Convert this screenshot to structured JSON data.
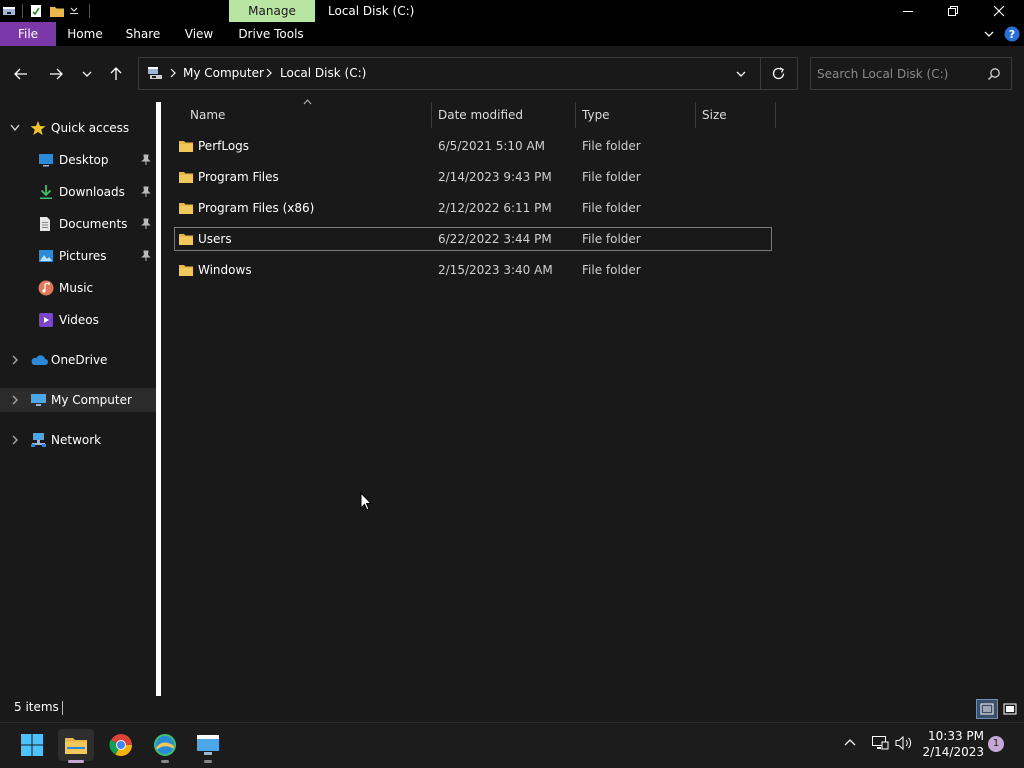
{
  "window": {
    "contextual_tab": "Manage",
    "title": "Local Disk (C:)"
  },
  "ribbon": {
    "tabs": [
      "File",
      "Home",
      "Share",
      "View",
      "Drive Tools"
    ]
  },
  "address": {
    "crumbs": [
      "My Computer",
      "Local Disk (C:)"
    ]
  },
  "search": {
    "placeholder": "Search Local Disk (C:)"
  },
  "nav_pane": {
    "quick_access": "Quick access",
    "pinned": [
      {
        "label": "Desktop",
        "icon": "desktop-icon"
      },
      {
        "label": "Downloads",
        "icon": "downloads-icon"
      },
      {
        "label": "Documents",
        "icon": "documents-icon"
      },
      {
        "label": "Pictures",
        "icon": "pictures-icon"
      }
    ],
    "library": [
      {
        "label": "Music",
        "icon": "music-icon"
      },
      {
        "label": "Videos",
        "icon": "videos-icon"
      }
    ],
    "onedrive": "OneDrive",
    "mycomputer": "My Computer",
    "network": "Network"
  },
  "columns": {
    "name": "Name",
    "date": "Date modified",
    "type": "Type",
    "size": "Size"
  },
  "files": [
    {
      "name": "PerfLogs",
      "date": "6/5/2021 5:10 AM",
      "type": "File folder"
    },
    {
      "name": "Program Files",
      "date": "2/14/2023 9:43 PM",
      "type": "File folder"
    },
    {
      "name": "Program Files (x86)",
      "date": "2/12/2022 6:11 PM",
      "type": "File folder"
    },
    {
      "name": "Users",
      "date": "6/22/2022 3:44 PM",
      "type": "File folder"
    },
    {
      "name": "Windows",
      "date": "2/15/2023 3:40 AM",
      "type": "File folder"
    }
  ],
  "status": {
    "items": "5 items"
  },
  "taskbar": {
    "time": "10:33 PM",
    "date": "2/14/2023",
    "notifications": "1"
  },
  "colors": {
    "file_tab": "#7b38a8",
    "manage_tab": "#b9e5a3",
    "folder": "#e8b94a",
    "background": "#191919"
  }
}
